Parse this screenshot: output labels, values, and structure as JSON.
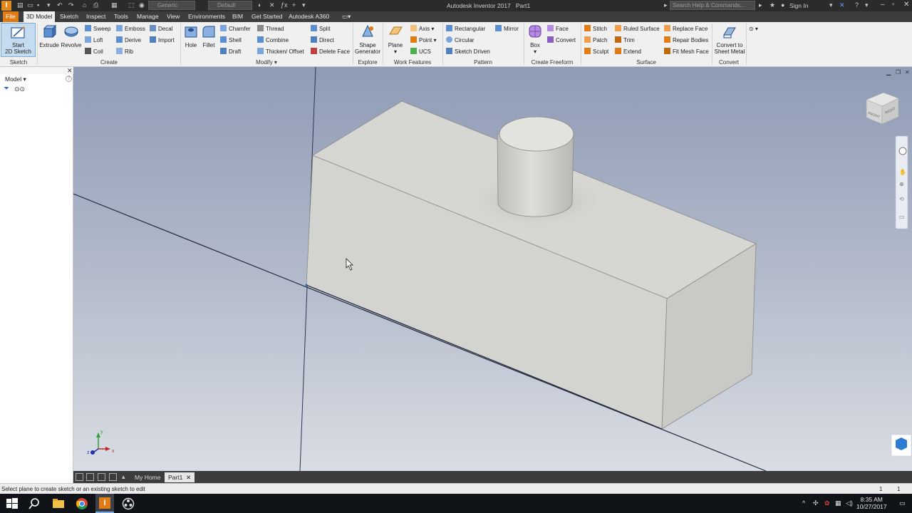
{
  "app": {
    "title": "Autodesk Inventor 2017",
    "document": "Part1",
    "appearance_combo": "Generic",
    "material_combo": "Default",
    "search_placeholder": "Search Help & Commands...",
    "sign_in": "Sign In"
  },
  "tabs": [
    "File",
    "3D Model",
    "Sketch",
    "Inspect",
    "Tools",
    "Manage",
    "View",
    "Environments",
    "BIM",
    "Get Started",
    "Autodesk A360"
  ],
  "ribbon": {
    "sketch": {
      "start_line1": "Start",
      "start_line2": "2D Sketch",
      "label": "Sketch"
    },
    "create": {
      "label": "Create",
      "extrude": "Extrude",
      "revolve": "Revolve",
      "col1": [
        "Sweep",
        "Loft",
        "Coil"
      ],
      "col2": [
        "Emboss",
        "Derive",
        "Rib"
      ],
      "col3": [
        "Decal",
        "Import"
      ]
    },
    "modify": {
      "label": "Modify",
      "hole": "Hole",
      "fillet": "Fillet",
      "col1": [
        "Chamfer",
        "Shell",
        "Draft"
      ],
      "col2": [
        "Thread",
        "Combine",
        "Thicken/ Offset"
      ],
      "col3": [
        "Split",
        "Direct",
        "Delete Face"
      ]
    },
    "explore": {
      "label": "Explore",
      "line1": "Shape",
      "line2": "Generator"
    },
    "work": {
      "label": "Work Features",
      "plane": "Plane",
      "items": [
        "Axis",
        "Point",
        "UCS"
      ]
    },
    "pattern": {
      "label": "Pattern",
      "items": [
        "Rectangular",
        "Circular",
        "Sketch Driven"
      ],
      "mirror": "Mirror"
    },
    "freeform": {
      "label": "Create Freeform",
      "box": "Box",
      "items": [
        "Face",
        "Convert"
      ]
    },
    "surface": {
      "label": "Surface",
      "col1": [
        "Stitch",
        "Patch",
        "Sculpt"
      ],
      "col2": [
        "Ruled Surface",
        "Trim",
        "Extend"
      ],
      "col3": [
        "Replace Face",
        "Repair Bodies",
        "Fit Mesh Face"
      ]
    },
    "convert": {
      "label": "Convert",
      "line1": "Convert to",
      "line2": "Sheet Metal"
    }
  },
  "browser": {
    "title": "Model"
  },
  "viewcube": {
    "front": "FRONT",
    "right": "RIGHT"
  },
  "doc_tabs": {
    "home": "My Home",
    "part": "Part1"
  },
  "status": {
    "message": "Select plane to create sketch or an existing sketch to edit",
    "count_a": "1",
    "count_b": "1"
  },
  "taskbar": {
    "time": "8:35 AM",
    "date": "10/27/2017"
  },
  "colors": {
    "accent_orange": "#e07b16",
    "ribbon_bg": "#f0f0f0",
    "viewport_top": "#8f9bb6",
    "viewport_bottom": "#d9dde4",
    "solid_face": "#d2d2cf"
  }
}
